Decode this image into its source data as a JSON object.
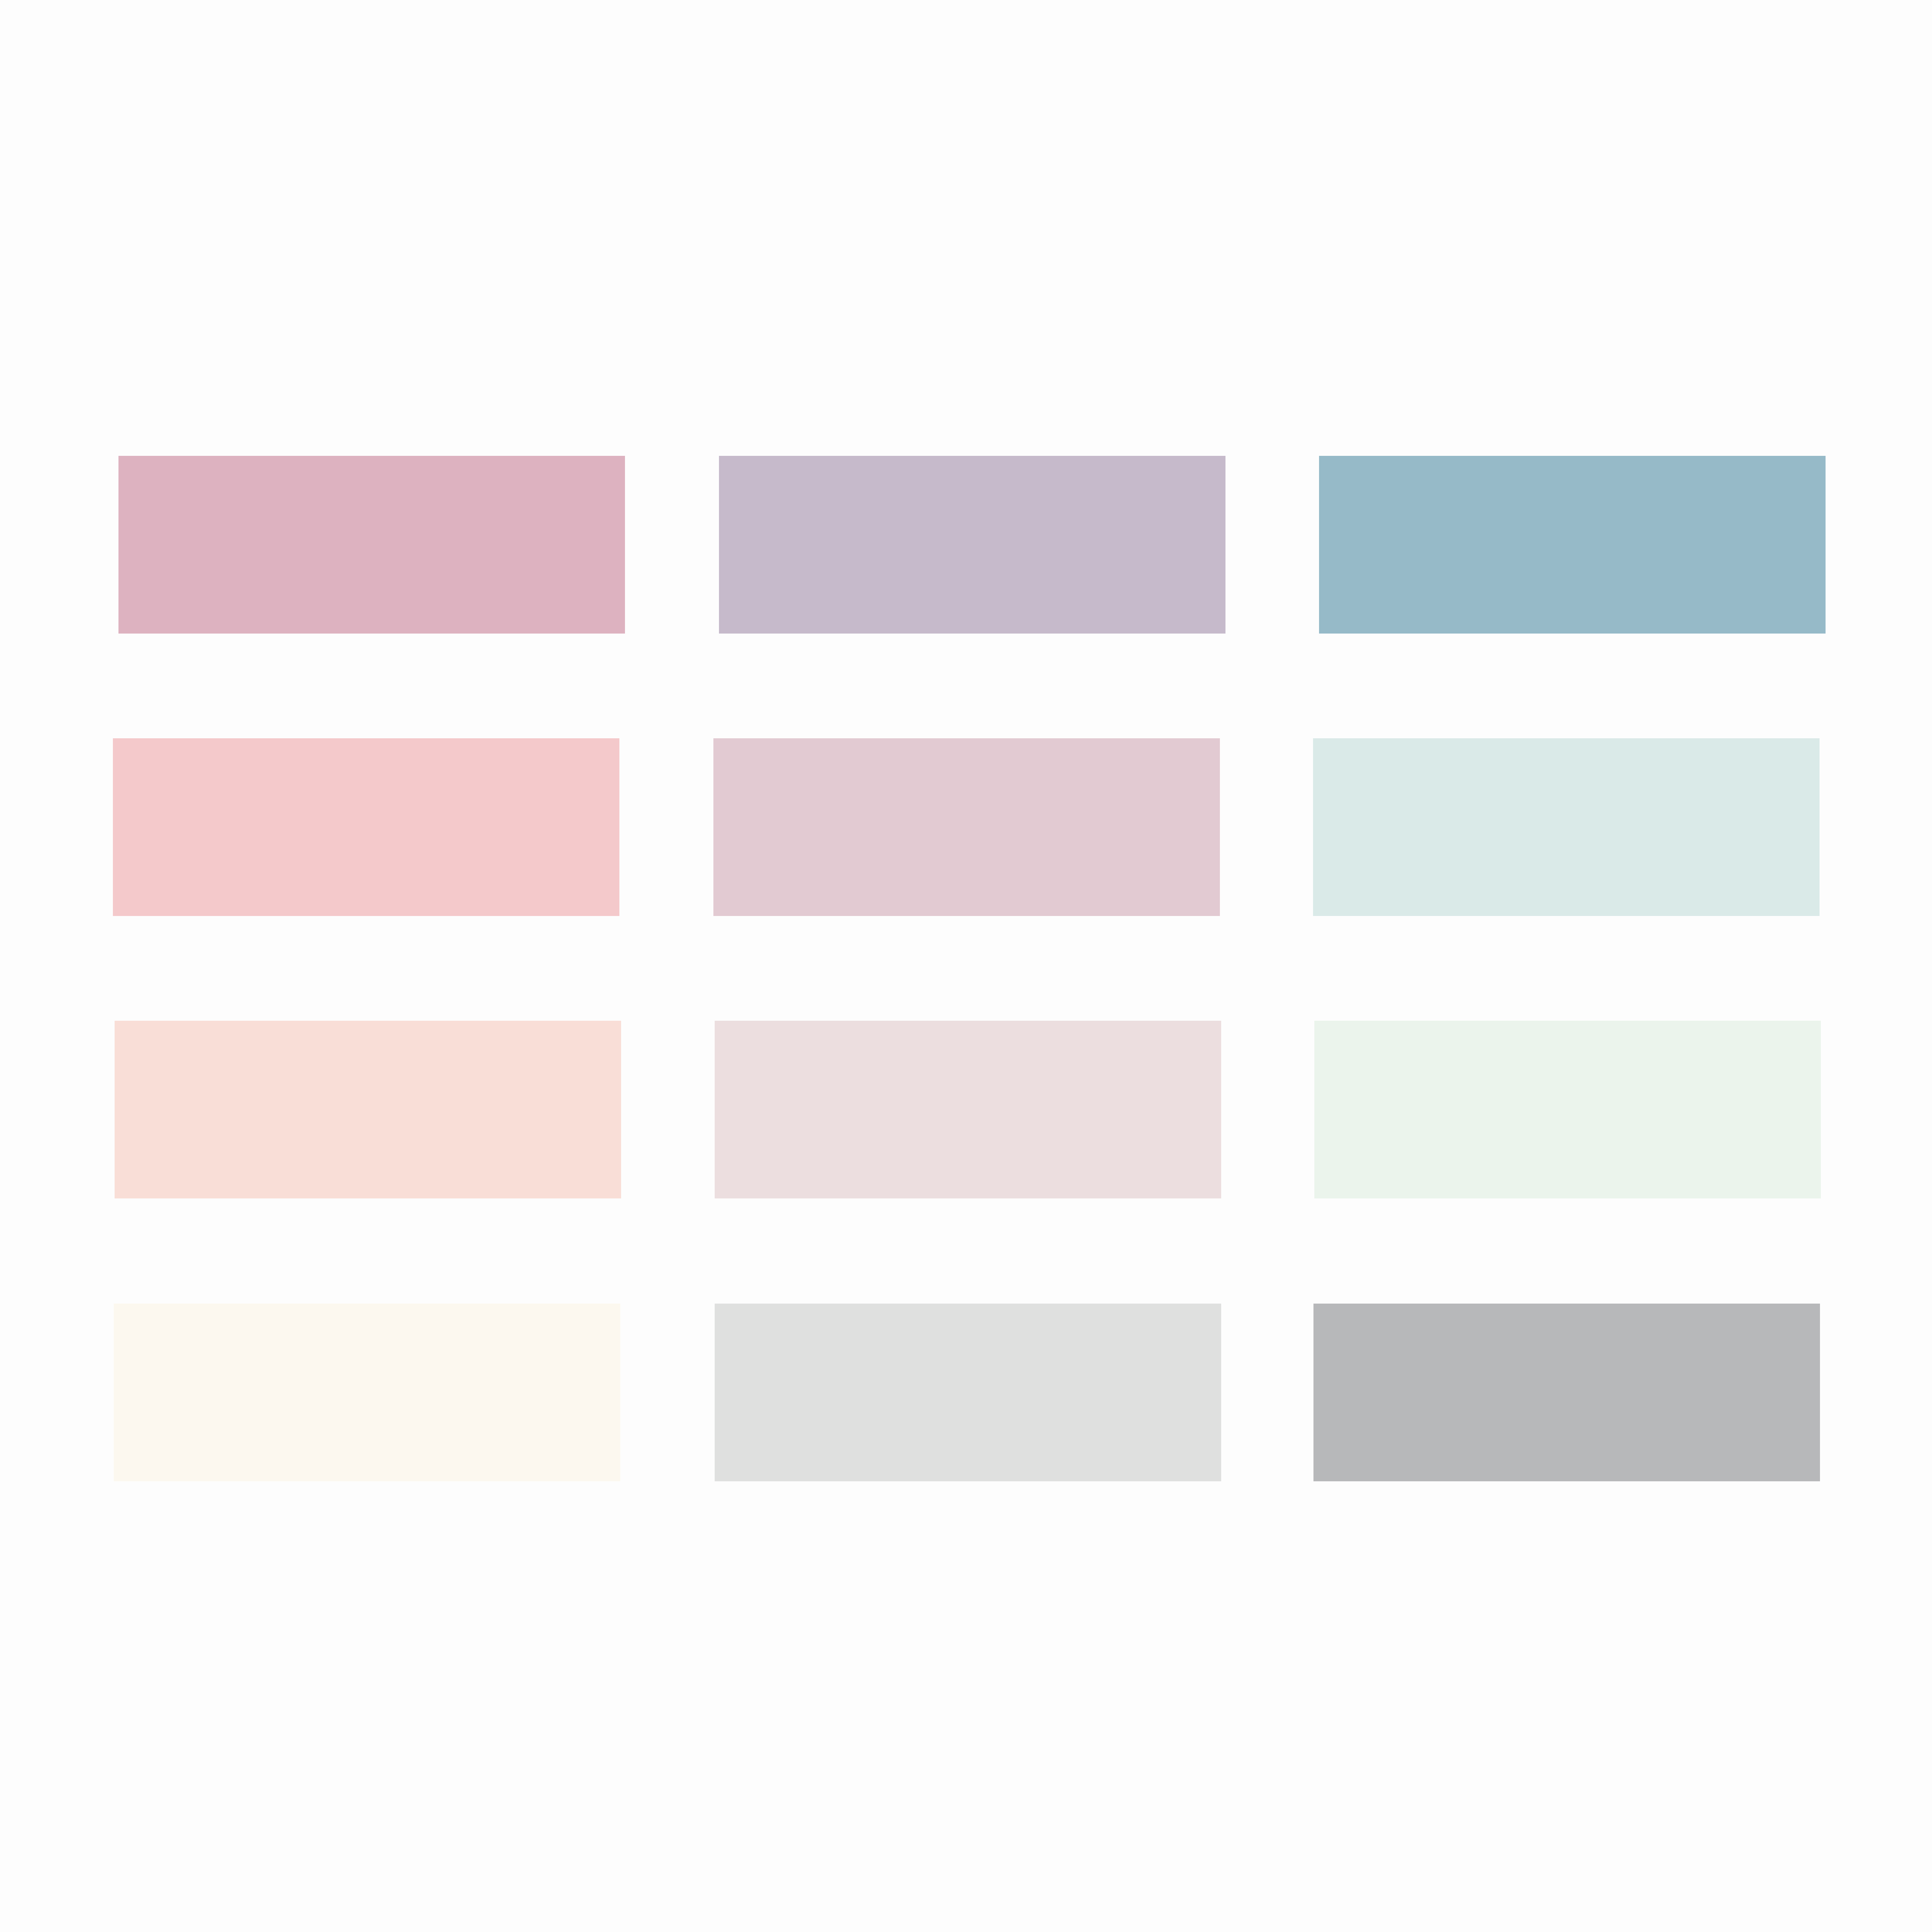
{
  "palette": {
    "swatches": [
      {
        "color": "#DDB2C0"
      },
      {
        "color": "#C6BACB"
      },
      {
        "color": "#96BAC8"
      },
      {
        "color": "#F4C9CB"
      },
      {
        "color": "#E2CAD2"
      },
      {
        "color": "#DAEAE8"
      },
      {
        "color": "#F9DED7"
      },
      {
        "color": "#ECDEDF"
      },
      {
        "color": "#EBF4EC"
      },
      {
        "color": "#FCF8EF"
      },
      {
        "color": "#DFE0DF"
      },
      {
        "color": "#B7B8BA"
      }
    ]
  }
}
